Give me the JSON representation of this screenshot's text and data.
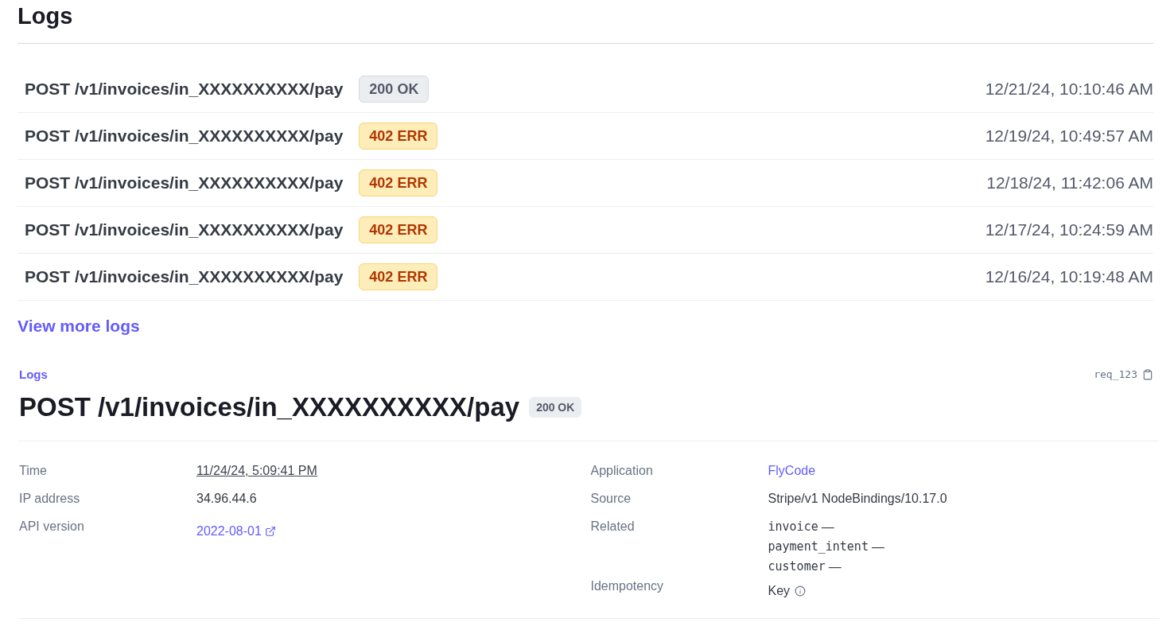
{
  "title": "Logs",
  "logs": [
    {
      "request": "POST /v1/invoices/in_XXXXXXXXXX/pay",
      "status": "200 OK",
      "kind": "ok",
      "time": "12/21/24, 10:10:46 AM"
    },
    {
      "request": "POST /v1/invoices/in_XXXXXXXXXX/pay",
      "status": "402 ERR",
      "kind": "error",
      "time": "12/19/24, 10:49:57 AM"
    },
    {
      "request": "POST /v1/invoices/in_XXXXXXXXXX/pay",
      "status": "402 ERR",
      "kind": "error",
      "time": "12/18/24, 11:42:06 AM"
    },
    {
      "request": "POST /v1/invoices/in_XXXXXXXXXX/pay",
      "status": "402 ERR",
      "kind": "error",
      "time": "12/17/24, 10:24:59 AM"
    },
    {
      "request": "POST /v1/invoices/in_XXXXXXXXXX/pay",
      "status": "402 ERR",
      "kind": "error",
      "time": "12/16/24, 10:19:48 AM"
    }
  ],
  "view_more": "View more logs",
  "detail": {
    "breadcrumb": "Logs",
    "request_id": "req_123",
    "title": "POST /v1/invoices/in_XXXXXXXXXX/pay",
    "status": "200 OK",
    "left": [
      {
        "label": "Time",
        "kind": "date",
        "value": "11/24/24, 5:09:41 PM"
      },
      {
        "label": "IP address",
        "kind": "text",
        "value": "34.96.44.6"
      },
      {
        "label": "API version",
        "kind": "external",
        "value": "2022-08-01"
      }
    ],
    "right": [
      {
        "label": "Application",
        "kind": "link",
        "value": "FlyCode"
      },
      {
        "label": "Source",
        "kind": "text",
        "value": "Stripe/v1 NodeBindings/10.17.0"
      },
      {
        "label": "Related",
        "kind": "related",
        "items": [
          {
            "name": "invoice",
            "value": "—"
          },
          {
            "name": "payment_intent",
            "value": "—"
          },
          {
            "name": "customer",
            "value": "—"
          }
        ]
      },
      {
        "label": "Idempotency",
        "kind": "info",
        "value": "Key"
      }
    ]
  }
}
